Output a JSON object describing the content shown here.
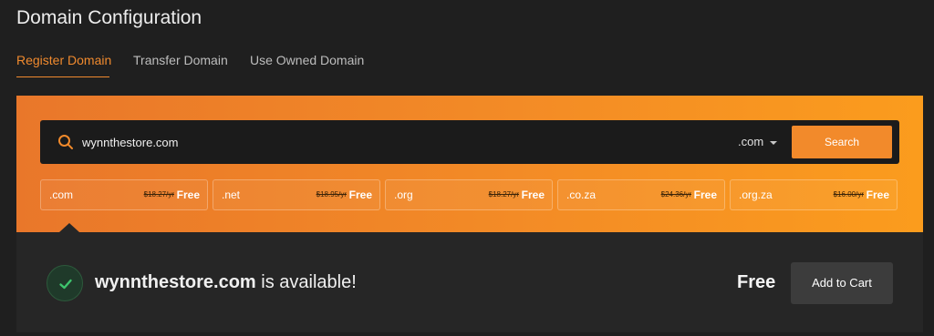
{
  "page": {
    "title": "Domain Configuration"
  },
  "tabs": [
    {
      "label": "Register Domain",
      "active": true
    },
    {
      "label": "Transfer Domain",
      "active": false
    },
    {
      "label": "Use Owned Domain",
      "active": false
    }
  ],
  "search": {
    "value": "wynnthestore.com",
    "tld_selected": ".com",
    "button_label": "Search"
  },
  "tld_options": [
    {
      "tld": ".com",
      "old_price": "$18.27/yr",
      "price": "Free"
    },
    {
      "tld": ".net",
      "old_price": "$18.95/yr",
      "price": "Free"
    },
    {
      "tld": ".org",
      "old_price": "$18.27/yr",
      "price": "Free"
    },
    {
      "tld": ".co.za",
      "old_price": "$24.36/yr",
      "price": "Free"
    },
    {
      "tld": ".org.za",
      "old_price": "$16.00/yr",
      "price": "Free"
    }
  ],
  "result": {
    "domain": "wynnthestore.com",
    "status_text": " is available!",
    "price": "Free",
    "button_label": "Add to Cart"
  },
  "colors": {
    "accent": "#f28a2b",
    "background": "#1f1f1f",
    "success": "#3ec46d"
  },
  "icons": [
    "search-icon",
    "chevron-down-icon",
    "check-icon"
  ]
}
